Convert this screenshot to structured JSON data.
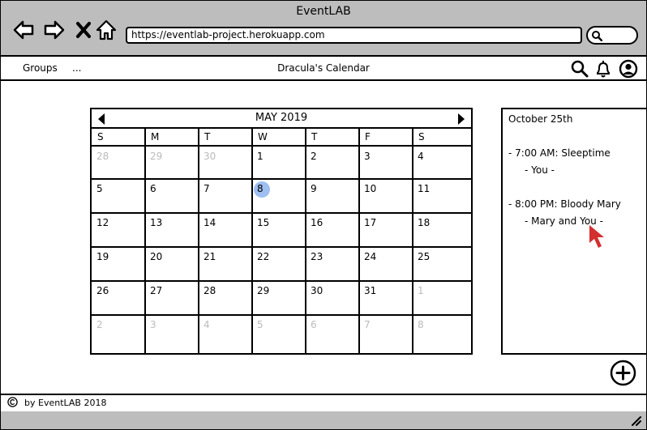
{
  "window": {
    "title": "EventLAB"
  },
  "browser": {
    "url": "https://eventlab-project.herokuapp.com",
    "icons": [
      "back-arrow-icon",
      "forward-arrow-icon",
      "close-x-icon",
      "home-icon",
      "search-icon"
    ]
  },
  "appbar": {
    "groups_label": "Groups",
    "more_label": "...",
    "title": "Dracula's Calendar",
    "icons": [
      "search-icon",
      "bell-icon",
      "user-avatar-icon"
    ]
  },
  "calendar": {
    "month_label": "MAY 2019",
    "weekdays": [
      "S",
      "M",
      "T",
      "W",
      "T",
      "F",
      "S"
    ],
    "today": "8",
    "weeks": [
      [
        {
          "d": "28",
          "muted": true
        },
        {
          "d": "29",
          "muted": true
        },
        {
          "d": "30",
          "muted": true
        },
        {
          "d": "1"
        },
        {
          "d": "2"
        },
        {
          "d": "3"
        },
        {
          "d": "4"
        }
      ],
      [
        {
          "d": "5"
        },
        {
          "d": "6"
        },
        {
          "d": "7"
        },
        {
          "d": "8",
          "today": true
        },
        {
          "d": "9"
        },
        {
          "d": "10"
        },
        {
          "d": "11"
        }
      ],
      [
        {
          "d": "12"
        },
        {
          "d": "13"
        },
        {
          "d": "14"
        },
        {
          "d": "15"
        },
        {
          "d": "16"
        },
        {
          "d": "17"
        },
        {
          "d": "18"
        }
      ],
      [
        {
          "d": "19"
        },
        {
          "d": "20"
        },
        {
          "d": "21"
        },
        {
          "d": "22"
        },
        {
          "d": "23"
        },
        {
          "d": "24"
        },
        {
          "d": "25"
        }
      ],
      [
        {
          "d": "26"
        },
        {
          "d": "27"
        },
        {
          "d": "28"
        },
        {
          "d": "29"
        },
        {
          "d": "30"
        },
        {
          "d": "31"
        },
        {
          "d": "1",
          "muted": true
        }
      ],
      [
        {
          "d": "2",
          "muted": true
        },
        {
          "d": "3",
          "muted": true
        },
        {
          "d": "4",
          "muted": true
        },
        {
          "d": "5",
          "muted": true
        },
        {
          "d": "6",
          "muted": true
        },
        {
          "d": "7",
          "muted": true
        },
        {
          "d": "8",
          "muted": true
        }
      ]
    ]
  },
  "events_panel": {
    "date": "October 25th",
    "events": [
      {
        "line": "- 7:00 AM:  Sleeptime",
        "attendees": "- You -"
      },
      {
        "line": "- 8:00 PM:  Bloody Mary",
        "attendees": "- Mary and You -"
      }
    ]
  },
  "footer": {
    "text": "by EventLAB 2018",
    "icon": "copyright-icon"
  },
  "colors": {
    "chrome": "#bdbdbd",
    "today_highlight": "#9fbff0",
    "cursor": "#d32f2f"
  }
}
